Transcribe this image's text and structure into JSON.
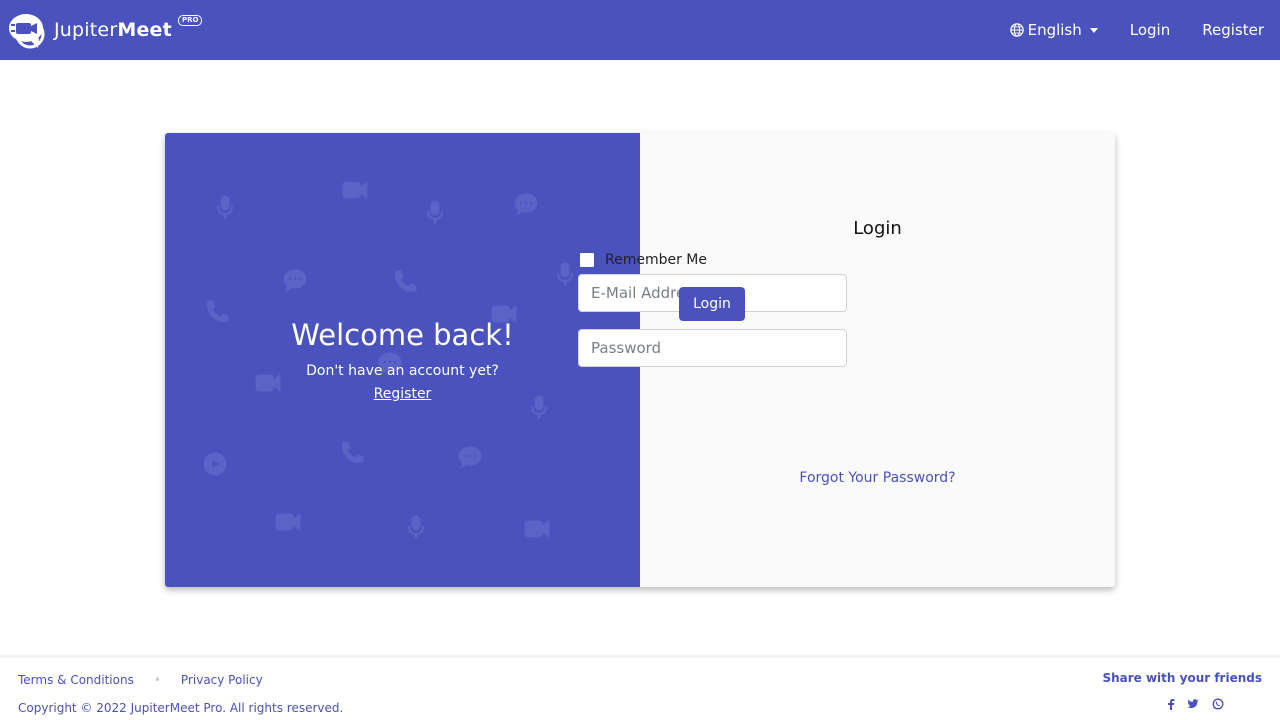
{
  "header": {
    "brand": {
      "name_regular": "Jupiter",
      "name_bold": "Meet",
      "badge": "PRO"
    },
    "nav": {
      "language": "English",
      "login": "Login",
      "register": "Register"
    }
  },
  "welcome": {
    "title": "Welcome back!",
    "subtitle": "Don't have an account yet?",
    "register_link": "Register"
  },
  "login_form": {
    "title": "Login",
    "email_placeholder": "E-Mail Address",
    "password_placeholder": "Password",
    "remember_label": "Remember Me",
    "remember_checked": false,
    "submit": "Login",
    "forgot_link": "Forgot Your Password?"
  },
  "footer": {
    "terms": "Terms & Conditions",
    "separator": "•",
    "privacy": "Privacy Policy",
    "copyright": "Copyright © 2022 JupiterMeet Pro. All rights reserved.",
    "share_title": "Share with your friends",
    "share_icons": [
      "facebook-icon",
      "twitter-icon",
      "whatsapp-icon"
    ]
  },
  "colors": {
    "primary": "#4a52bd",
    "right_panel": "#fafafa",
    "text_dark": "#111111",
    "pattern_icons": "#5a63c6"
  },
  "pattern_icons": [
    "microphone-icon",
    "video-camera-icon",
    "chat-bubble-icon",
    "phone-icon",
    "play-icon"
  ]
}
